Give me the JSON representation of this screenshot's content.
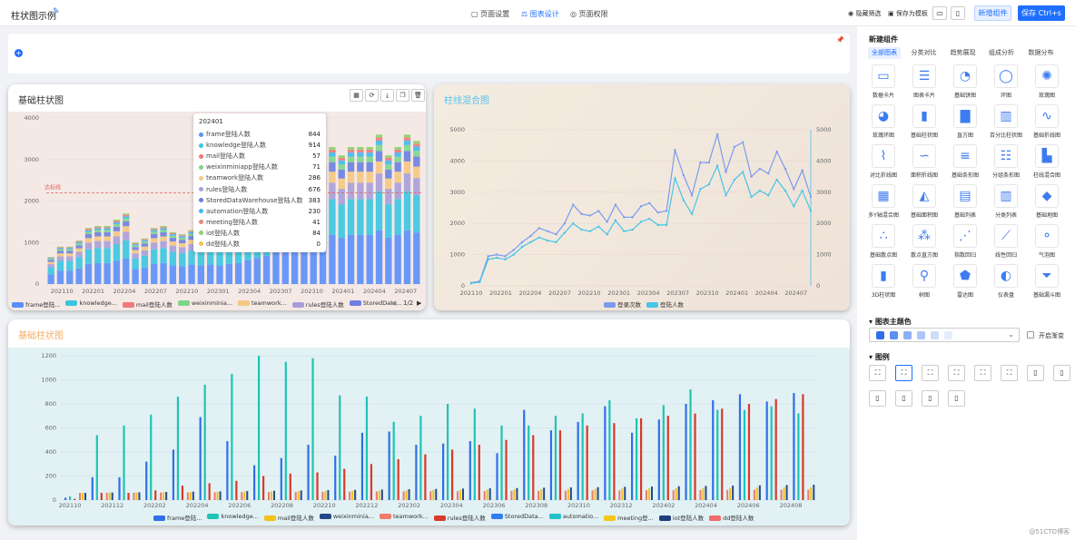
{
  "topbar": {
    "title": "柱状图示例",
    "tabs": [
      "页面设置",
      "图表设计",
      "页面权限"
    ],
    "hide_filter": "隐藏筛选",
    "save_template": "保存为模板",
    "new_component": "新增组件",
    "save": "保存 Ctrl+s"
  },
  "chart1": {
    "title": "基础柱状图",
    "target_line_label": "达标线",
    "legend_page": "1/2",
    "tooltip": {
      "header": "202401",
      "rows": [
        {
          "name": "frame登陆人数",
          "value": "844",
          "color": "#5b8ff9"
        },
        {
          "name": "knowledge登陆人数",
          "value": "914",
          "color": "#38c6e0"
        },
        {
          "name": "mail登陆人数",
          "value": "57",
          "color": "#f0787a"
        },
        {
          "name": "weixinminiapp登陆人数",
          "value": "71",
          "color": "#7ed68a"
        },
        {
          "name": "teamwork登陆人数",
          "value": "286",
          "color": "#f5c880"
        },
        {
          "name": "rules登陆人数",
          "value": "676",
          "color": "#a89fd8"
        },
        {
          "name": "StoredDataWarehouse登陆人数",
          "value": "383",
          "color": "#6c7fe0"
        },
        {
          "name": "automation登陆人数",
          "value": "230",
          "color": "#3fb8f0"
        },
        {
          "name": "meeting登陆人数",
          "value": "41",
          "color": "#e8877d"
        },
        {
          "name": "iot登陆人数",
          "value": "84",
          "color": "#8fcf6a"
        },
        {
          "name": "dd登陆人数",
          "value": "0",
          "color": "#f3c34e"
        }
      ]
    },
    "legend": [
      {
        "name": "frame登陆...",
        "color": "#5b8ff9"
      },
      {
        "name": "knowledge...",
        "color": "#38c6e0"
      },
      {
        "name": "mail登陆人数",
        "color": "#f0787a"
      },
      {
        "name": "weixinminia...",
        "color": "#7ed68a"
      },
      {
        "name": "teamwork...",
        "color": "#f5c880"
      },
      {
        "name": "rules登陆人数",
        "color": "#a89fd8"
      },
      {
        "name": "StoredData...",
        "color": "#6c7fe0"
      }
    ]
  },
  "chart2": {
    "title": "柱线混合图",
    "legend": [
      {
        "name": "登录次数",
        "color": "#7b9cf0"
      },
      {
        "name": "登陆人数",
        "color": "#46c5e8"
      }
    ]
  },
  "chart3": {
    "title": "基础柱状图",
    "legend": [
      {
        "name": "frame登陆...",
        "color": "#2f6fea"
      },
      {
        "name": "knowledge...",
        "color": "#1fc4b4"
      },
      {
        "name": "mail登陆人数",
        "color": "#f2c21b"
      },
      {
        "name": "weixinminia...",
        "color": "#23488a"
      },
      {
        "name": "teamwork...",
        "color": "#f07a6a"
      },
      {
        "name": "rules登陆人数",
        "color": "#d83a2b"
      },
      {
        "name": "StoredData...",
        "color": "#2f7ef5"
      },
      {
        "name": "automatio...",
        "color": "#22c1c9"
      },
      {
        "name": "meeting登...",
        "color": "#f5c518"
      },
      {
        "name": "iot登陆人数",
        "color": "#1f3f7a"
      },
      {
        "name": "dd登陆人数",
        "color": "#f06a6a"
      }
    ]
  },
  "chart_data": [
    {
      "type": "bar",
      "stacked": true,
      "title": "基础柱状图",
      "ylim": [
        0,
        4000
      ],
      "x_ticks": [
        "202110",
        "202201",
        "202204",
        "202207",
        "202210",
        "202301",
        "202304",
        "202307",
        "202310",
        "202401",
        "202404",
        "202407"
      ],
      "totals": [
        650,
        900,
        900,
        1050,
        1350,
        1400,
        1400,
        1550,
        1700,
        1000,
        1100,
        1350,
        1400,
        1250,
        1200,
        1300,
        1250,
        1300,
        1250,
        1350,
        1400,
        1600,
        1750,
        1900,
        2200,
        2450,
        3200,
        3500,
        3350,
        2900,
        3300,
        3100,
        3300,
        3300,
        3300,
        3600,
        3100,
        3300,
        3600,
        3450
      ],
      "annotations": [
        {
          "type": "hline",
          "value": 2200,
          "label": "达标线"
        }
      ]
    },
    {
      "type": "line",
      "title": "柱线混合图",
      "ylim": [
        0,
        5000
      ],
      "y2lim": [
        0,
        5000
      ],
      "x_ticks": [
        "202110",
        "202201",
        "202204",
        "202207",
        "202210",
        "202301",
        "202304",
        "202307",
        "202310",
        "202401",
        "202404",
        "202407"
      ],
      "series": [
        {
          "name": "登录次数",
          "values": [
            100,
            150,
            950,
            1000,
            950,
            1150,
            1400,
            1600,
            1850,
            1750,
            1650,
            2000,
            2600,
            2300,
            2250,
            2400,
            2050,
            2600,
            2200,
            2200,
            2550,
            2650,
            2350,
            2400,
            4350,
            3550,
            2900,
            3950,
            3950,
            4850,
            3650,
            4450,
            4600,
            3500,
            3750,
            3600,
            4300,
            3750,
            3100,
            3700,
            2850
          ]
        },
        {
          "name": "登陆人数",
          "values": [
            80,
            120,
            850,
            900,
            850,
            1000,
            1250,
            1400,
            1550,
            1450,
            1400,
            1700,
            2000,
            1800,
            1750,
            1900,
            1650,
            2100,
            1750,
            1800,
            2050,
            2150,
            1950,
            1950,
            3450,
            2750,
            2300,
            3100,
            3250,
            3850,
            2900,
            3400,
            3650,
            2850,
            3050,
            2900,
            3400,
            3050,
            2550,
            3050,
            2400
          ]
        }
      ]
    },
    {
      "type": "bar",
      "title": "基础柱状图",
      "ylim": [
        0,
        1200
      ],
      "x_ticks": [
        "202110",
        "202112",
        "202202",
        "202204",
        "202206",
        "202208",
        "202210",
        "202212",
        "202302",
        "202304",
        "202306",
        "202308",
        "202310",
        "202312",
        "202402",
        "202404",
        "202406",
        "202408"
      ],
      "series": [
        {
          "name": "frame",
          "values": [
            20,
            190,
            190,
            320,
            420,
            690,
            490,
            290,
            350,
            460,
            370,
            560,
            570,
            460,
            470,
            490,
            390,
            750,
            580,
            650,
            780,
            560,
            670,
            800,
            830,
            880,
            820,
            890
          ]
        },
        {
          "name": "knowledge",
          "values": [
            30,
            540,
            620,
            710,
            860,
            960,
            1050,
            1200,
            1150,
            1180,
            870,
            860,
            650,
            700,
            800,
            760,
            620,
            620,
            700,
            720,
            830,
            680,
            790,
            920,
            750,
            750,
            780,
            720
          ]
        },
        {
          "name": "rules",
          "values": [
            10,
            60,
            60,
            80,
            120,
            140,
            160,
            200,
            220,
            230,
            260,
            300,
            340,
            380,
            420,
            460,
            500,
            540,
            580,
            620,
            640,
            680,
            700,
            720,
            760,
            800,
            840,
            880
          ]
        }
      ]
    }
  ],
  "panel": {
    "h_new": "新建组件",
    "tabs": [
      "全部图表",
      "分类对比",
      "趋势展现",
      "组成分析",
      "数据分布"
    ],
    "items": [
      "数据卡片",
      "图表卡片",
      "基础饼图",
      "环图",
      "玫瑰图",
      "玫瑰环图",
      "基础柱状图",
      "直方图",
      "百分比柱状图",
      "基础折线图",
      "对比折线图",
      "面积折线图",
      "基础条形图",
      "分组条形图",
      "柱线混合图",
      "多Y轴混合图",
      "基础面积图",
      "基础列表",
      "分类列表",
      "基础地图",
      "基础散点图",
      "散点直方图",
      "指数回归",
      "线性回归",
      "气泡图",
      "3D柱状图",
      "树图",
      "雷达图",
      "仪表盘",
      "基础漏斗图"
    ],
    "h_theme": "图表主题色",
    "gradient": "开启渐变",
    "h_legend": "图例"
  },
  "watermark": "@51CTO博客",
  "colors": {
    "primary": "#1e6fff"
  }
}
